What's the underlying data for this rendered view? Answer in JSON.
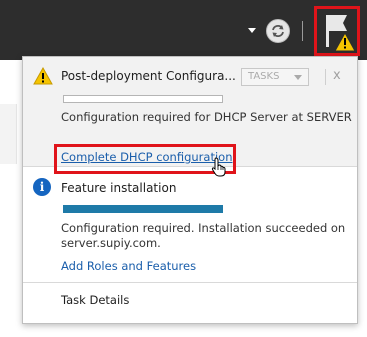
{
  "notifications": [
    {
      "title": "Post-deployment Configura...",
      "tasks_label": "TASKS",
      "close_label": "x",
      "message": "Configuration required for DHCP Server at SERVER",
      "link": "Complete DHCP configuration",
      "progress": 0
    },
    {
      "title": "Feature installation",
      "message": "Configuration required. Installation succeeded on server.supiy.com.",
      "link": "Add Roles and Features",
      "progress": 1
    }
  ],
  "footer": {
    "task_details": "Task Details"
  },
  "colors": {
    "highlight": "#e0141a",
    "link": "#1a5eab",
    "progress": "#1e7aa8",
    "warning": "#f5c400",
    "info": "#1565c0"
  },
  "icons": [
    "dropdown-arrow-icon",
    "refresh-icon",
    "flag-warning-icon",
    "warning-icon",
    "info-icon",
    "hand-cursor-icon"
  ]
}
